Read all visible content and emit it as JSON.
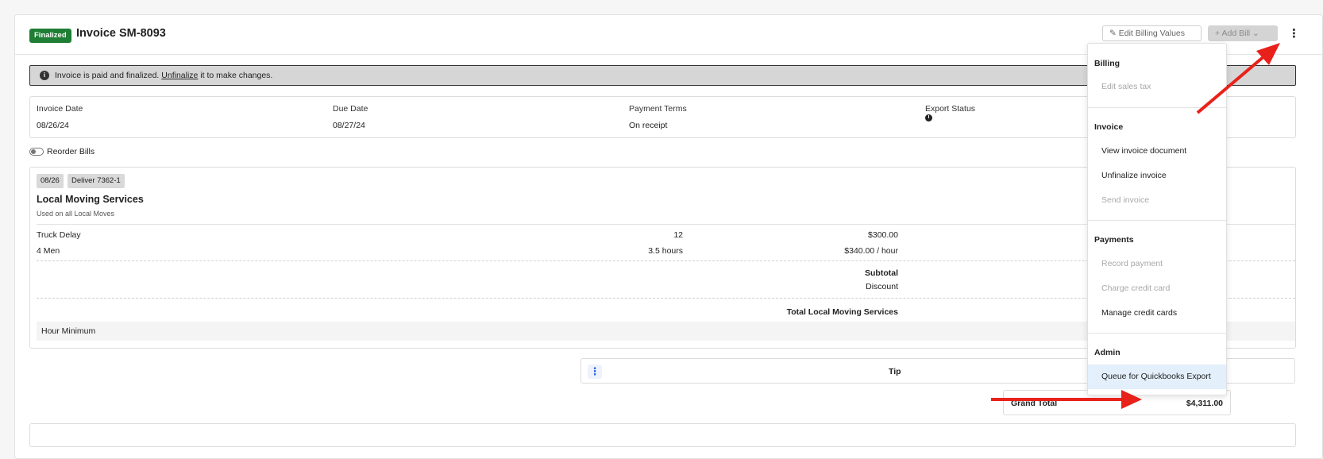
{
  "header": {
    "status_badge": "Finalized",
    "title": "Invoice SM-8093",
    "edit_billing_label": "Edit Billing Values",
    "add_bill_label": "Add Bill"
  },
  "notice": {
    "prefix": "Invoice is paid and finalized.",
    "link": "Unfinalize",
    "suffix": "it to make changes."
  },
  "meta": {
    "invoice_date_label": "Invoice Date",
    "invoice_date": "08/26/24",
    "due_date_label": "Due Date",
    "due_date": "08/27/24",
    "payment_terms_label": "Payment Terms",
    "payment_terms": "On receipt",
    "export_status_label": "Export Status"
  },
  "reorder_label": "Reorder Bills",
  "bill": {
    "tags": [
      "08/26",
      "Deliver 7362-1"
    ],
    "title": "Local Moving Services",
    "subtitle": "Used on all Local Moves",
    "lines": [
      {
        "name": "Truck Delay",
        "qty": "12",
        "rate": "$300.00"
      },
      {
        "name": "4 Men",
        "qty": "3.5 hours",
        "rate": "$340.00 / hour"
      }
    ],
    "subtotal_label": "Subtotal",
    "discount_label": "Discount",
    "total_label": "Total Local Moving Services",
    "minimum_label": "Hour Minimum"
  },
  "tip_label": "Tip",
  "grand_total": {
    "label": "Grand Total",
    "value": "$4,311.00"
  },
  "menu": {
    "billing": {
      "heading": "Billing",
      "items": [
        {
          "label": "Edit sales tax",
          "disabled": true
        }
      ]
    },
    "invoice": {
      "heading": "Invoice",
      "items": [
        {
          "label": "View invoice document",
          "disabled": false
        },
        {
          "label": "Unfinalize invoice",
          "disabled": false
        },
        {
          "label": "Send invoice",
          "disabled": true
        }
      ]
    },
    "payments": {
      "heading": "Payments",
      "items": [
        {
          "label": "Record payment",
          "disabled": true
        },
        {
          "label": "Charge credit card",
          "disabled": true
        },
        {
          "label": "Manage credit cards",
          "disabled": false
        }
      ]
    },
    "admin": {
      "heading": "Admin",
      "items": [
        {
          "label": "Queue for Quickbooks Export",
          "disabled": false
        }
      ]
    }
  },
  "colors": {
    "finalized_badge": "#1e7e34",
    "annotation_arrow": "#e8211b",
    "menu_highlight": "#e3effb"
  }
}
